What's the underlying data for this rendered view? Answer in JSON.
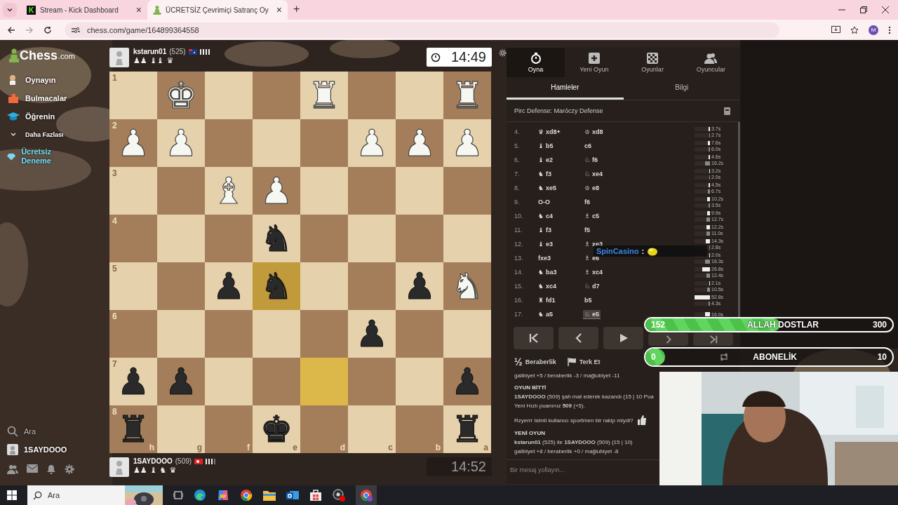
{
  "browser": {
    "tabs": [
      {
        "title": "Stream - Kick Dashboard",
        "favicon": "K",
        "selected": false
      },
      {
        "title": "ÜCRETSİZ Çevrimiçi Satranç Oy",
        "selected": true
      }
    ],
    "new_tab": "+",
    "close": "×",
    "url": "chess.com/game/164899364558",
    "profile": "M"
  },
  "sidebar": {
    "logo": {
      "main": "Chess",
      "suffix": ".com"
    },
    "items": [
      {
        "label": "Oynayın",
        "kind": "nav"
      },
      {
        "label": "Bulmacalar",
        "kind": "nav"
      },
      {
        "label": "Öğrenin",
        "kind": "nav"
      },
      {
        "label": "Daha Fazlası",
        "kind": "more"
      },
      {
        "label": "Ücretsiz Deneme",
        "kind": "promo"
      }
    ],
    "search": "Ara",
    "user": "1SAYDOOO"
  },
  "top_player": {
    "name": "kstarun01",
    "rating": "(525)",
    "captured": [
      "♟♟",
      "♝♝",
      "♛"
    ],
    "clock": "14:49",
    "clock_active": true
  },
  "bottom_player": {
    "name": "1SAYDOOO",
    "rating": "(509)",
    "captured": [
      "♟♟",
      "♝",
      "♞",
      "♛"
    ],
    "clock": "14:52",
    "clock_active": false
  },
  "board": {
    "files": [
      "h",
      "g",
      "f",
      "e",
      "d",
      "c",
      "b",
      "a"
    ],
    "ranks": [
      {
        "label": "1",
        "cells": [
          {
            "highlighted": false
          },
          {
            "piece": "♚",
            "white": true,
            "highlighted": false
          },
          {
            "highlighted": false
          },
          {
            "highlighted": false
          },
          {
            "piece": "♜",
            "white": true,
            "highlighted": false
          },
          {
            "highlighted": false
          },
          {
            "highlighted": false
          },
          {
            "piece": "♜",
            "white": true,
            "highlighted": false
          }
        ]
      },
      {
        "label": "2",
        "cells": [
          {
            "piece": "♟",
            "white": true,
            "highlighted": false
          },
          {
            "piece": "♟",
            "white": true,
            "highlighted": false
          },
          {
            "highlighted": false
          },
          {
            "highlighted": false
          },
          {
            "highlighted": false
          },
          {
            "piece": "♟",
            "white": true,
            "highlighted": false
          },
          {
            "piece": "♟",
            "white": true,
            "highlighted": false
          },
          {
            "piece": "♟",
            "white": true,
            "highlighted": false
          }
        ]
      },
      {
        "label": "3",
        "cells": [
          {
            "highlighted": false
          },
          {
            "highlighted": false
          },
          {
            "piece": "♝",
            "white": true,
            "highlighted": false
          },
          {
            "piece": "♟",
            "white": true,
            "highlighted": false
          },
          {
            "highlighted": false
          },
          {
            "highlighted": false
          },
          {
            "highlighted": false
          },
          {
            "highlighted": false
          }
        ]
      },
      {
        "label": "4",
        "cells": [
          {
            "highlighted": false
          },
          {
            "highlighted": false
          },
          {
            "highlighted": false
          },
          {
            "piece": "♞",
            "white": false,
            "highlighted": false
          },
          {
            "highlighted": false
          },
          {
            "highlighted": false
          },
          {
            "highlighted": false
          },
          {
            "highlighted": false
          }
        ]
      },
      {
        "label": "5",
        "cells": [
          {
            "highlighted": false
          },
          {
            "highlighted": false
          },
          {
            "piece": "♟",
            "white": false,
            "highlighted": false
          },
          {
            "piece": "♞",
            "white": false,
            "highlighted": true
          },
          {
            "highlighted": false
          },
          {
            "highlighted": false
          },
          {
            "piece": "♟",
            "white": false,
            "highlighted": false
          },
          {
            "piece": "♞",
            "white": true,
            "highlighted": false
          }
        ]
      },
      {
        "label": "6",
        "cells": [
          {
            "highlighted": false
          },
          {
            "highlighted": false
          },
          {
            "highlighted": false
          },
          {
            "highlighted": false
          },
          {
            "highlighted": false
          },
          {
            "piece": "♟",
            "white": false,
            "highlighted": false
          },
          {
            "highlighted": false
          },
          {
            "highlighted": false
          }
        ]
      },
      {
        "label": "7",
        "cells": [
          {
            "piece": "♟",
            "white": false,
            "highlighted": false
          },
          {
            "piece": "♟",
            "white": false,
            "highlighted": false
          },
          {
            "highlighted": false
          },
          {
            "highlighted": false
          },
          {
            "highlighted": true
          },
          {
            "highlighted": false
          },
          {
            "highlighted": false
          },
          {
            "piece": "♟",
            "white": false,
            "highlighted": false
          }
        ]
      },
      {
        "label": "8",
        "cells": [
          {
            "piece": "♜",
            "white": false,
            "highlighted": false
          },
          {
            "highlighted": false
          },
          {
            "highlighted": false
          },
          {
            "piece": "♚",
            "white": false,
            "highlighted": false
          },
          {
            "highlighted": false
          },
          {
            "highlighted": false
          },
          {
            "highlighted": false
          },
          {
            "piece": "♜",
            "white": false,
            "highlighted": false
          }
        ]
      }
    ]
  },
  "panel": {
    "nav": [
      {
        "label": "Oyna",
        "selected": true
      },
      {
        "label": "Yeni Oyun",
        "selected": false
      },
      {
        "label": "Oyunlar",
        "selected": false
      },
      {
        "label": "Oyuncular",
        "selected": false
      }
    ],
    "tabs": [
      {
        "label": "Hamleler",
        "selected": true
      },
      {
        "label": "Bilgi",
        "selected": false
      }
    ],
    "opening": "Pirc Defense: Maróczy Defense",
    "moves": [
      {
        "number": "4.",
        "white": {
          "glyph": "♛",
          "san": "xd8+",
          "selected": false
        },
        "black": {
          "glyph": "♔",
          "san": "xd8",
          "selected": false
        },
        "times": [
          {
            "text": "3.7s",
            "level": 0.07
          },
          {
            "text": "2.7s",
            "level": 0.05
          }
        ]
      },
      {
        "number": "5.",
        "white": {
          "glyph": "♝",
          "san": "b5",
          "selected": false
        },
        "black": {
          "san": "c6",
          "selected": false
        },
        "times": [
          {
            "text": "7.6s",
            "level": 0.14
          },
          {
            "text": "6.0s",
            "level": 0.11
          }
        ]
      },
      {
        "number": "6.",
        "white": {
          "glyph": "♝",
          "san": "e2",
          "selected": false
        },
        "black": {
          "glyph": "♘",
          "san": "f6",
          "selected": false
        },
        "times": [
          {
            "text": "4.6s",
            "level": 0.09
          },
          {
            "text": "16.2s",
            "level": 0.31
          }
        ]
      },
      {
        "number": "7.",
        "white": {
          "glyph": "♞",
          "san": "f3",
          "selected": false
        },
        "black": {
          "glyph": "♘",
          "san": "xe4",
          "selected": false
        },
        "times": [
          {
            "text": "3.2s",
            "level": 0.06
          },
          {
            "text": "2.0s",
            "level": 0.04
          }
        ]
      },
      {
        "number": "8.",
        "white": {
          "glyph": "♞",
          "san": "xe5",
          "selected": false
        },
        "black": {
          "glyph": "♔",
          "san": "e8",
          "selected": false
        },
        "times": [
          {
            "text": "4.5s",
            "level": 0.09
          },
          {
            "text": "6.7s",
            "level": 0.13
          }
        ]
      },
      {
        "number": "9.",
        "white": {
          "san": "O-O",
          "selected": false
        },
        "black": {
          "san": "f6",
          "selected": false
        },
        "times": [
          {
            "text": "10.2s",
            "level": 0.19
          },
          {
            "text": "3.5s",
            "level": 0.07
          }
        ]
      },
      {
        "number": "10.",
        "white": {
          "glyph": "♞",
          "san": "c4",
          "selected": false
        },
        "black": {
          "glyph": "♗",
          "san": "c5",
          "selected": false
        },
        "times": [
          {
            "text": "9.9s",
            "level": 0.19
          },
          {
            "text": "12.7s",
            "level": 0.24
          }
        ]
      },
      {
        "number": "11.",
        "white": {
          "glyph": "♝",
          "san": "f3",
          "selected": false
        },
        "black": {
          "san": "f5",
          "selected": false
        },
        "times": [
          {
            "text": "12.2s",
            "level": 0.23
          },
          {
            "text": "11.0s",
            "level": 0.21
          }
        ]
      },
      {
        "number": "12.",
        "white": {
          "glyph": "♝",
          "san": "e3",
          "selected": false
        },
        "black": {
          "glyph": "♗",
          "san": "xe3",
          "selected": false
        },
        "times": [
          {
            "text": "14.3s",
            "level": 0.27
          },
          {
            "text": "2.8s",
            "level": 0.05
          }
        ]
      },
      {
        "number": "13.",
        "white": {
          "san": "fxe3",
          "selected": false
        },
        "black": {
          "glyph": "♗",
          "san": "e6",
          "selected": false
        },
        "times": [
          {
            "text": "2.0s",
            "level": 0.04
          },
          {
            "text": "16.3s",
            "level": 0.31
          }
        ]
      },
      {
        "number": "14.",
        "white": {
          "glyph": "♞",
          "san": "ba3",
          "selected": false
        },
        "black": {
          "glyph": "♗",
          "san": "xc4",
          "selected": false
        },
        "times": [
          {
            "text": "26.8s",
            "level": 0.51
          },
          {
            "text": "12.4s",
            "level": 0.23
          }
        ]
      },
      {
        "number": "15.",
        "white": {
          "glyph": "♞",
          "san": "xc4",
          "selected": false
        },
        "black": {
          "glyph": "♘",
          "san": "d7",
          "selected": false
        },
        "times": [
          {
            "text": "2.1s",
            "level": 0.04
          },
          {
            "text": "10.5s",
            "level": 0.2
          }
        ]
      },
      {
        "number": "16.",
        "white": {
          "glyph": "♜",
          "san": "fd1",
          "selected": false
        },
        "black": {
          "san": "b5",
          "selected": false
        },
        "times": [
          {
            "text": "52.8s",
            "level": 1
          },
          {
            "text": "4.3s",
            "level": 0.08
          }
        ]
      },
      {
        "number": "17.",
        "white": {
          "glyph": "♞",
          "san": "a5",
          "selected": false
        },
        "black": {
          "glyph": "♘",
          "san": "e5",
          "selected": true
        },
        "times": [
          {
            "text": "16.0s",
            "level": 0.3
          }
        ]
      }
    ],
    "actions": [
      {
        "glyph": "½",
        "label": "Beraberlik"
      },
      {
        "label": "Terk Et"
      }
    ],
    "chat": [
      {
        "kind": "text",
        "text": "galibiyet +5 / beraberlik -3 / mağlubiyet -11"
      },
      {
        "kind": "heading",
        "text": "OYUN BİTTİ"
      },
      {
        "kind": "text",
        "text": "**1SAYDOOO** (509) şah mat ederek kazandı (15 | 10 Pua"
      },
      {
        "kind": "text",
        "text": "Yeni Hızlı puanınız **509** (+5)."
      },
      {
        "kind": "question",
        "text": "Rzyerrr isimli kullanıcı sportmen bir rakip miydi?"
      },
      {
        "kind": "heading",
        "text": "YENİ OYUN"
      },
      {
        "kind": "text",
        "text": "**kstarun01** (525) ile **1SAYDOOO** (509) (15 | 10)"
      },
      {
        "kind": "text",
        "text": "galibiyet +8 / beraberlik +0 / mağlubiyet -8"
      }
    ],
    "message": {
      "placeholder": "Bir mesaj yollayın..."
    }
  },
  "overlay": {
    "chat_user": "SpinCasino",
    "separator": ":",
    "goals": [
      {
        "current": "152",
        "title": "ALLAH DOSTLAR",
        "target": "300",
        "level": 0.507
      },
      {
        "current": "0",
        "title": "ABONELİK",
        "target": "10",
        "level": 0
      }
    ]
  },
  "taskbar": {
    "search": "Ara"
  }
}
